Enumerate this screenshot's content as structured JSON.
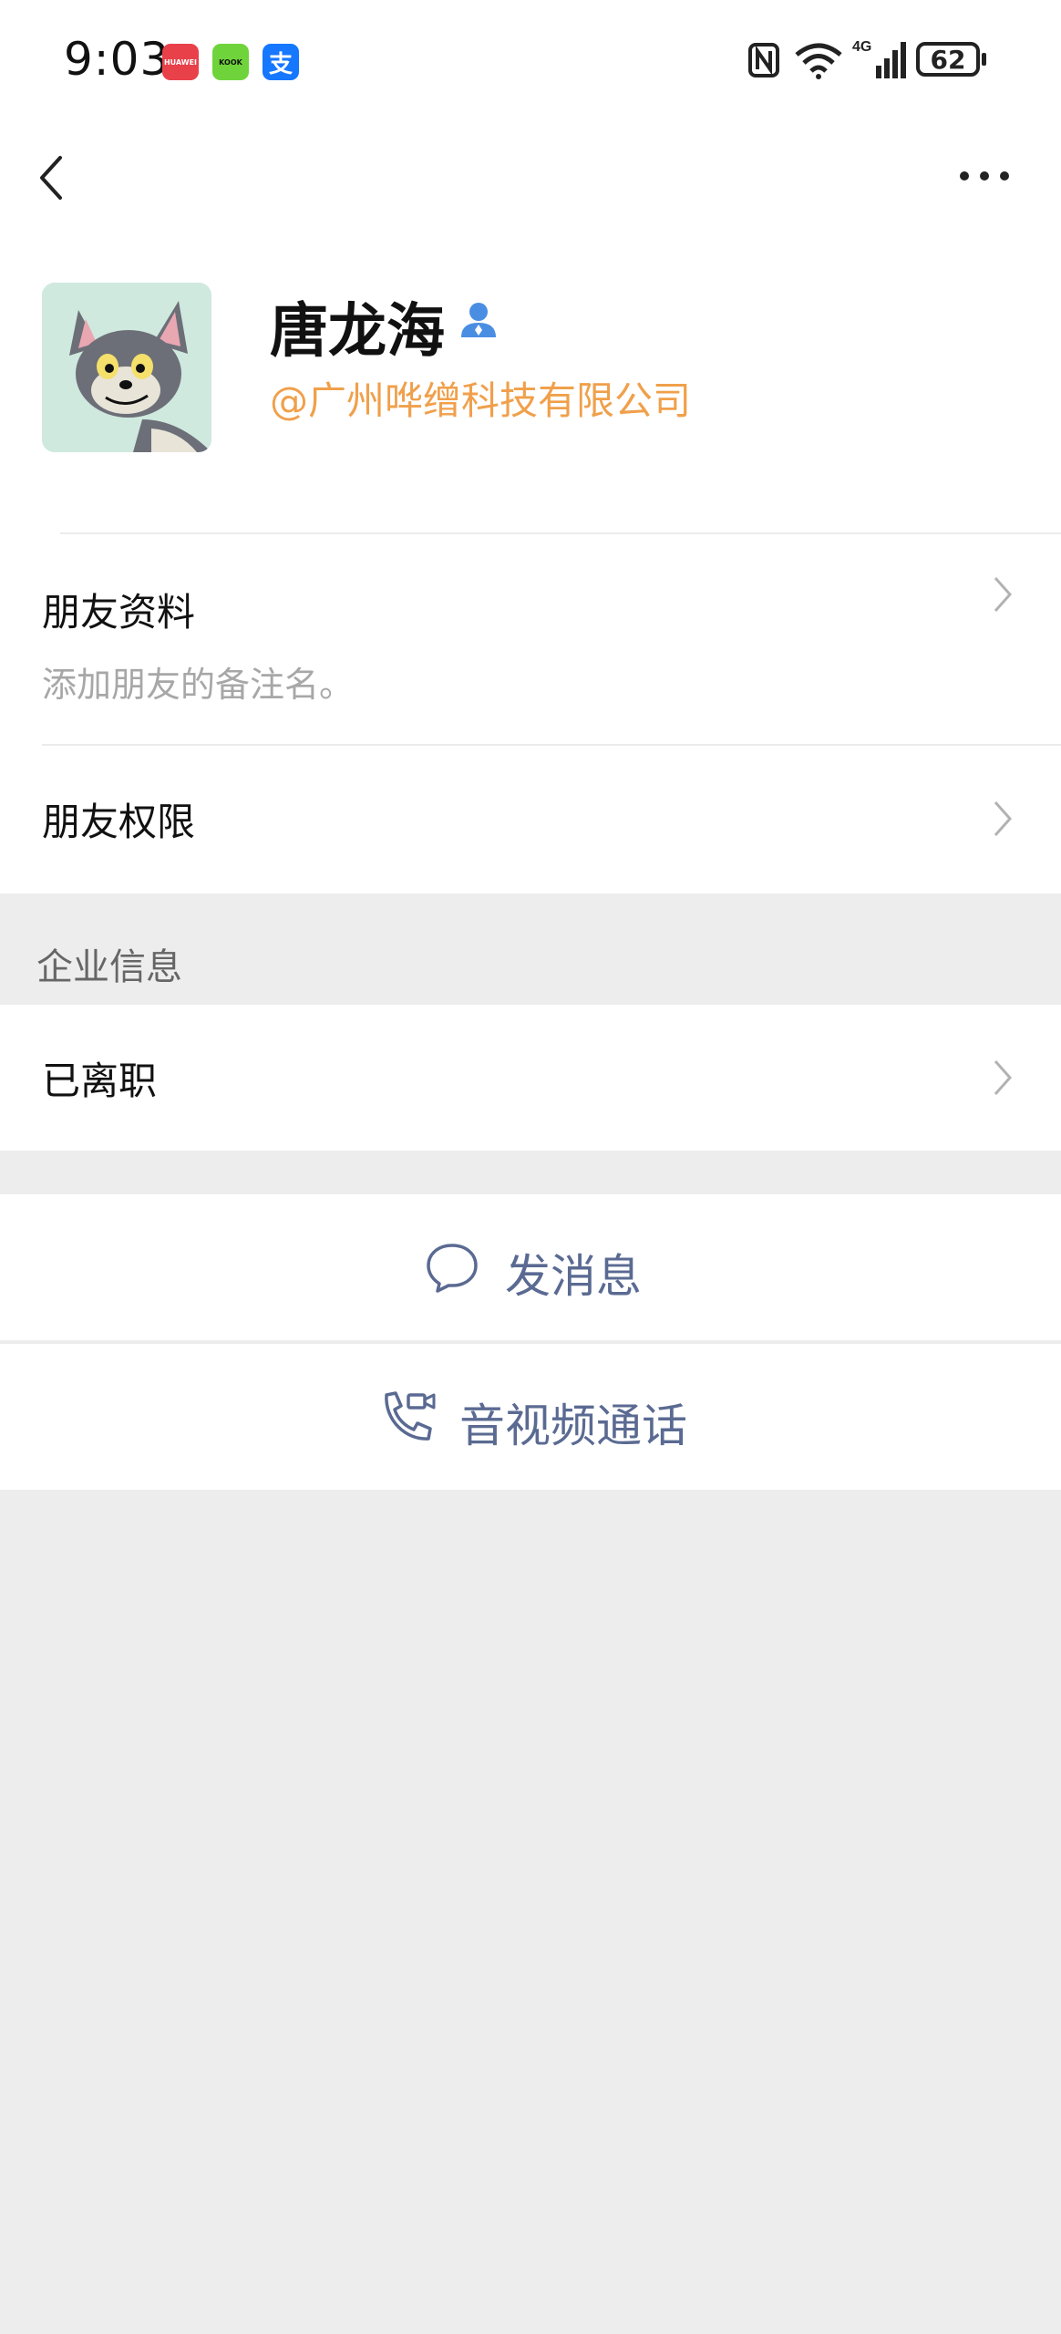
{
  "status_bar": {
    "time": "9:03",
    "apps": [
      "HUAWEI",
      "KOOK",
      "支"
    ],
    "battery": "62",
    "network": "4G"
  },
  "nav": {
    "back_icon": "chevron-left-icon",
    "more_icon": "more-dots-icon"
  },
  "profile": {
    "name": "唐龙海",
    "company": "@广州哗缯科技有限公司",
    "accent_color": "#f0a04b"
  },
  "rows": {
    "friend_info": {
      "label": "朋友资料",
      "sub": "添加朋友的备注名。"
    },
    "friend_permission": {
      "label": "朋友权限"
    },
    "enterprise_section": "企业信息",
    "resigned": {
      "label": "已离职"
    }
  },
  "actions": {
    "send_message": "发消息",
    "video_call": "音视频通话",
    "color": "#5a6a92"
  }
}
